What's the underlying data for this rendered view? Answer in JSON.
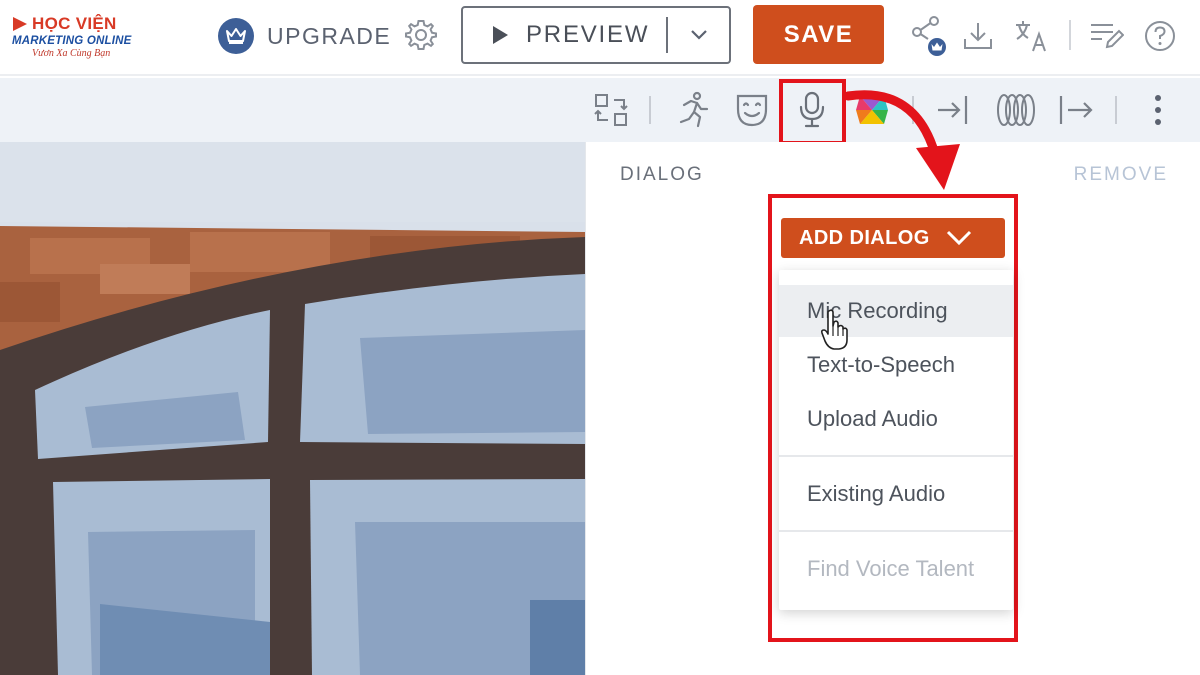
{
  "logo": {
    "line1": "HỌC VIỆN",
    "line2": "MARKETING ONLINE",
    "line3": "Vươn Xa Cùng Bạn"
  },
  "topbar": {
    "upgrade_label": "UPGRADE",
    "preview_label": "PREVIEW",
    "save_label": "SAVE"
  },
  "panel": {
    "title": "DIALOG",
    "remove_label": "REMOVE",
    "add_dialog_label": "ADD DIALOG",
    "menu": [
      {
        "label": "Mic Recording",
        "state": "hover"
      },
      {
        "label": "Text-to-Speech",
        "state": "normal"
      },
      {
        "label": "Upload Audio",
        "state": "normal"
      },
      {
        "label": "Existing Audio",
        "state": "normal"
      },
      {
        "label": "Find Voice Talent",
        "state": "disabled"
      }
    ]
  },
  "colors": {
    "accent": "#cf4e1d",
    "highlight": "#e3141b",
    "crown_badge": "#3d5f97",
    "toolbar_bg": "#eef2f7"
  }
}
